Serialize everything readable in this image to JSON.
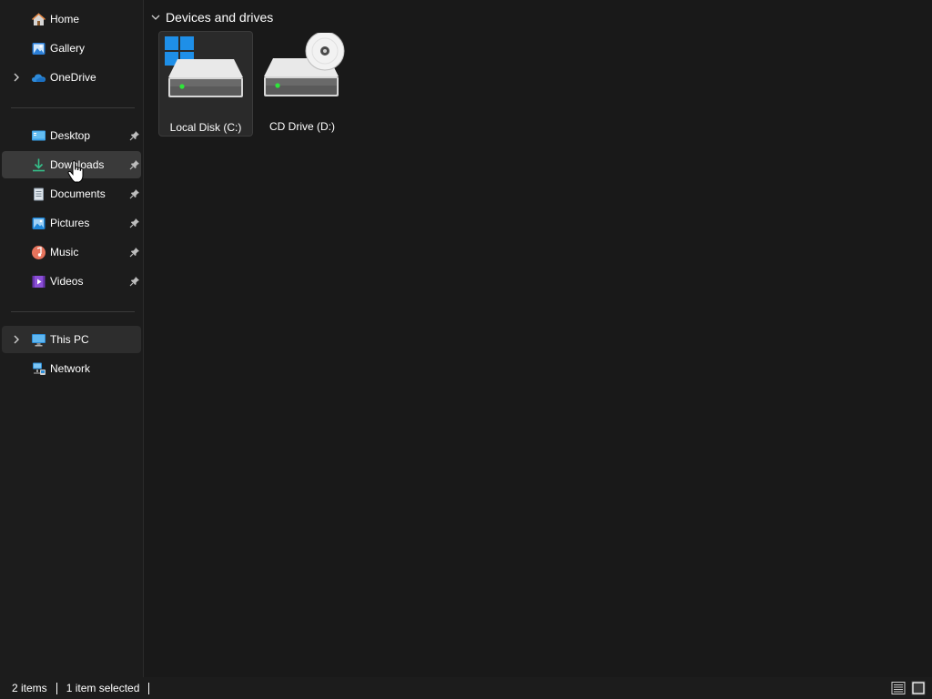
{
  "sidebar": {
    "quick": [
      {
        "label": "Home",
        "icon": "home-icon"
      },
      {
        "label": "Gallery",
        "icon": "gallery-icon"
      },
      {
        "label": "OneDrive",
        "icon": "onedrive-icon",
        "expandable": true
      }
    ],
    "pinned": [
      {
        "label": "Desktop",
        "icon": "desktop-folder-icon"
      },
      {
        "label": "Downloads",
        "icon": "downloads-folder-icon"
      },
      {
        "label": "Documents",
        "icon": "documents-folder-icon"
      },
      {
        "label": "Pictures",
        "icon": "pictures-folder-icon"
      },
      {
        "label": "Music",
        "icon": "music-folder-icon"
      },
      {
        "label": "Videos",
        "icon": "videos-folder-icon"
      }
    ],
    "system": [
      {
        "label": "This PC",
        "icon": "this-pc-icon",
        "expandable": true
      },
      {
        "label": "Network",
        "icon": "network-icon"
      }
    ]
  },
  "main": {
    "group_title": "Devices and drives",
    "drives": [
      {
        "label": "Local Disk (C:)",
        "icon": "local-disk-icon",
        "selected": true
      },
      {
        "label": "CD Drive (D:)",
        "icon": "cd-drive-icon",
        "selected": false
      }
    ]
  },
  "status": {
    "item_count": "2 items",
    "selection": "1 item selected"
  },
  "colors": {
    "background": "#191919",
    "sidebar": "#1c1c1c",
    "hover": "#3a3a3a",
    "accent": "#0078d4",
    "led": "#2ee53a"
  }
}
